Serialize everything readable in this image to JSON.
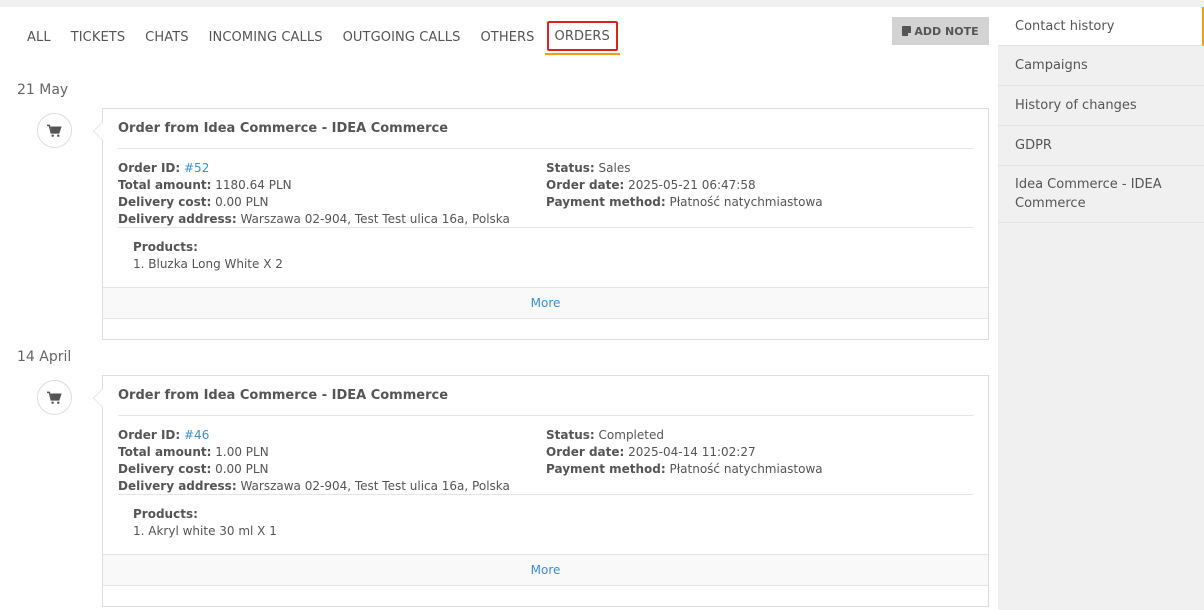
{
  "tabs": [
    {
      "label": "ALL"
    },
    {
      "label": "TICKETS"
    },
    {
      "label": "CHATS"
    },
    {
      "label": "INCOMING CALLS"
    },
    {
      "label": "OUTGOING CALLS"
    },
    {
      "label": "OTHERS"
    },
    {
      "label": "ORDERS"
    }
  ],
  "active_tab": "ORDERS",
  "add_note_label": "ADD NOTE",
  "entries": [
    {
      "date": "21 May",
      "title": "Order from Idea Commerce - IDEA Commerce",
      "labels": {
        "order_id": "Order ID:",
        "total_amount": "Total amount:",
        "delivery_cost": "Delivery cost:",
        "delivery_address": "Delivery address:",
        "status": "Status:",
        "order_date": "Order date:",
        "payment_method": "Payment method:",
        "products": "Products:"
      },
      "order_id": "#52",
      "total_amount": "1180.64 PLN",
      "delivery_cost": "0.00 PLN",
      "delivery_address": "Warszawa 02-904, Test Test ulica 16a, Polska",
      "status": "Sales",
      "order_date": "2025-05-21 06:47:58",
      "payment_method": "Płatność natychmiastowa",
      "products": [
        "1. Bluzka Long White X 2"
      ],
      "more_label": "More"
    },
    {
      "date": "14 April",
      "title": "Order from Idea Commerce - IDEA Commerce",
      "labels": {
        "order_id": "Order ID:",
        "total_amount": "Total amount:",
        "delivery_cost": "Delivery cost:",
        "delivery_address": "Delivery address:",
        "status": "Status:",
        "order_date": "Order date:",
        "payment_method": "Payment method:",
        "products": "Products:"
      },
      "order_id": "#46",
      "total_amount": "1.00 PLN",
      "delivery_cost": "0.00 PLN",
      "delivery_address": "Warszawa 02-904, Test Test ulica 16a, Polska",
      "status": "Completed",
      "order_date": "2025-04-14 11:02:27",
      "payment_method": "Płatność natychmiastowa",
      "products": [
        "1. Akryl white 30 ml X 1"
      ],
      "more_label": "More"
    }
  ],
  "sidebar": {
    "items": [
      {
        "label": "Contact history"
      },
      {
        "label": "Campaigns"
      },
      {
        "label": "History of changes"
      },
      {
        "label": "GDPR"
      },
      {
        "label": "Idea Commerce - IDEA Commerce"
      }
    ]
  },
  "colors": {
    "accent": "#f39c12",
    "link": "#3a8fd6",
    "highlight": "#e02020"
  },
  "icons": {
    "cart": "shopping-cart-icon",
    "note": "note-icon"
  }
}
